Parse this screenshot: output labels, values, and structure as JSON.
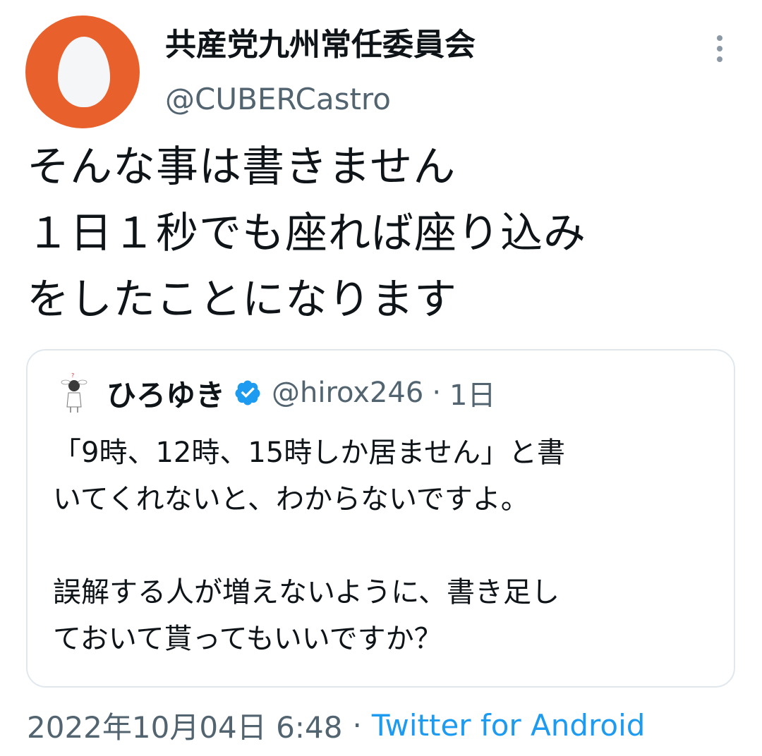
{
  "tweet": {
    "display_name": "共産党九州常任委員会",
    "handle": "@CUBERCastro",
    "text": "そんな事は書きません\n１日１秒でも座れば座り込み\nをしたことになります",
    "more_icon": "more-vertical-icon",
    "avatar_color": "#e8602c"
  },
  "quote": {
    "display_name": "ひろゆき",
    "verified_icon": "verified-badge-icon",
    "handle": "@hirox246",
    "separator": "·",
    "time": "1日",
    "text": "「9時、12時、15時しか居ません」と書\nいてくれないと、わからないですよ。\n\n誤解する人が増えないように、書き足し\nておいて貰ってもいいですか？"
  },
  "footer": {
    "timestamp": "2022年10月04日 6:48",
    "separator": "·",
    "source": "Twitter for Android"
  },
  "colors": {
    "text": "#0f1419",
    "secondary": "#536471",
    "link": "#1d9bf0",
    "verified": "#1d9bf0",
    "border": "#e1e8ed"
  }
}
